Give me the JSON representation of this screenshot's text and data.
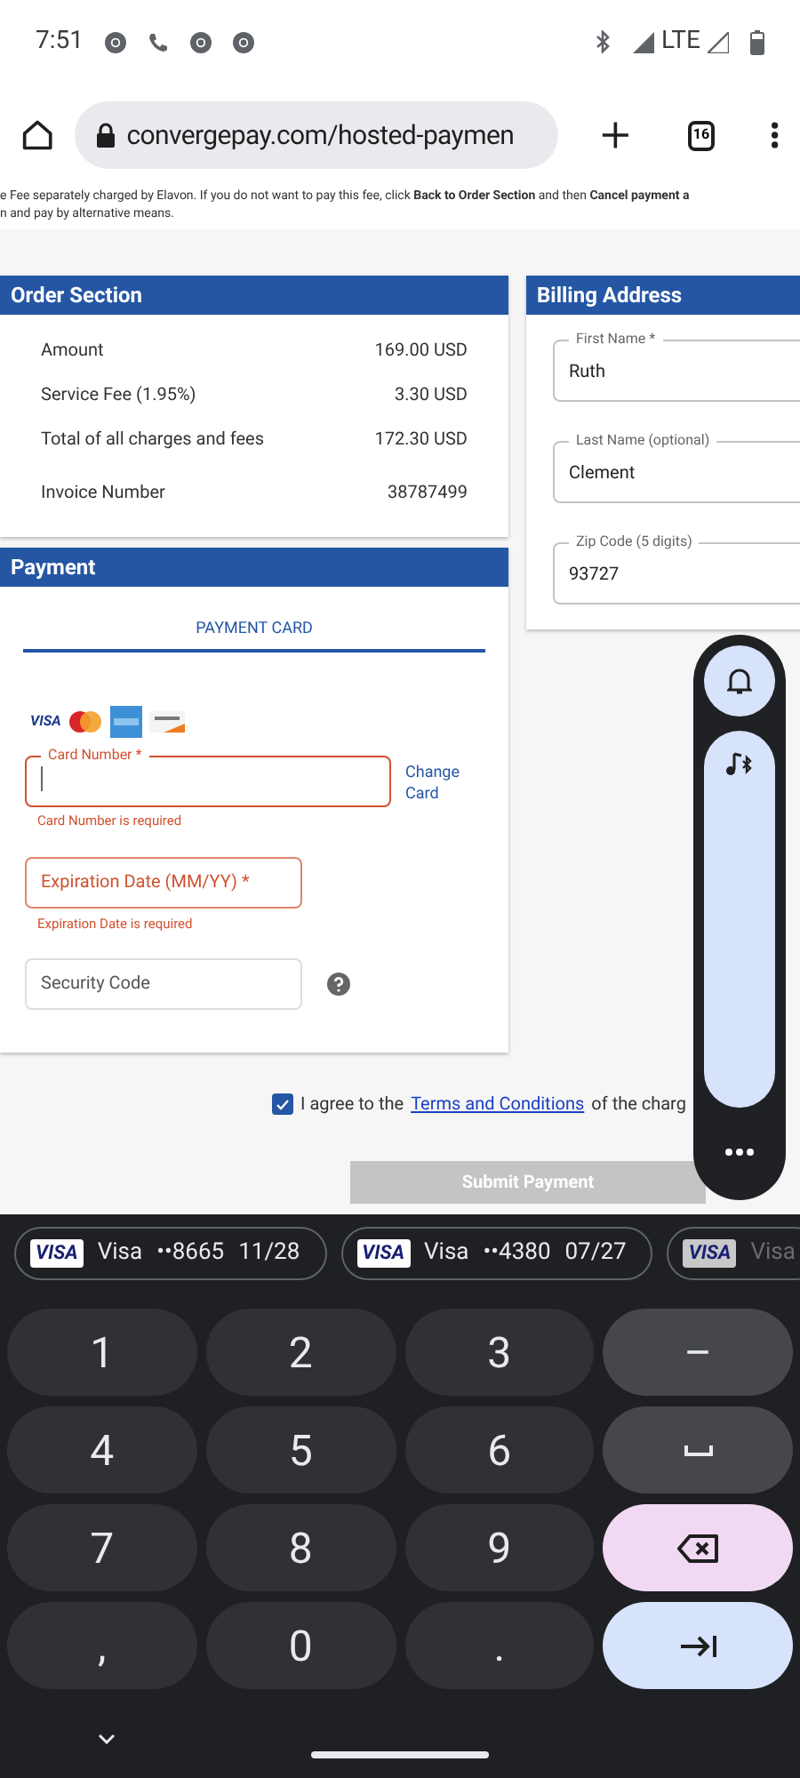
{
  "status_bar": {
    "time": "7:51",
    "network": "LTE"
  },
  "browser": {
    "url": "convergepay.com/hosted-paymen",
    "tab_count": "16"
  },
  "notice": [
    "e Fee separately charged by Elavon. If you do not want to pay this fee, click **Back to Order Section** and then **Cancel payment a**",
    "n and pay by alternative means."
  ],
  "order_section": {
    "title": "Order Section",
    "rows": [
      {
        "label": "Amount",
        "value": "169.00 USD"
      },
      {
        "label": "Service Fee (1.95%)",
        "value": "3.30 USD"
      },
      {
        "label": "Total of all charges and fees",
        "value": "172.30 USD"
      },
      {
        "label": "Invoice Number",
        "value": "38787499"
      }
    ]
  },
  "payment": {
    "title": "Payment",
    "tabs": [
      {
        "label": "PAYMENT CARD",
        "selected": true
      }
    ],
    "card_logos": [
      {
        "kind": "visa",
        "text": "VISA"
      },
      {
        "kind": "mastercard"
      },
      {
        "kind": "amex"
      },
      {
        "kind": "discover"
      }
    ],
    "card_number": {
      "label": "Card Number *",
      "error": "Card Number is required",
      "invalid": true,
      "focused": true
    },
    "change_card": "Change Card",
    "expiration": {
      "placeholder": "Expiration Date (MM/YY) *",
      "error": "Expiration Date is required",
      "invalid": true
    },
    "security_code": {
      "placeholder": "Security Code"
    }
  },
  "billing": {
    "title": "Billing Address",
    "fields": [
      {
        "label": "First Name *",
        "value": "Ruth"
      },
      {
        "label": "Last Name (optional)",
        "value": "Clement"
      },
      {
        "label": "Zip Code (5 digits)",
        "value": "93727"
      }
    ]
  },
  "agreement": {
    "checked": true,
    "before": "I agree to the",
    "link": "Terms and Conditions",
    "after": "of the charg"
  },
  "submit": {
    "label": "Submit Payment",
    "disabled": true
  },
  "keyboard": {
    "suggestions": [
      {
        "brand": "VISA",
        "name": "Visa",
        "number": "••8665",
        "expiry": "11/28",
        "faded": false
      },
      {
        "brand": "VISA",
        "name": "Visa",
        "number": "••4380",
        "expiry": "07/27",
        "faded": false
      },
      {
        "brand": "VISA",
        "name": "Visa",
        "faded": true
      }
    ],
    "keys": [
      {
        "kind": "char",
        "label": "1"
      },
      {
        "kind": "char",
        "label": "2"
      },
      {
        "kind": "char",
        "label": "3"
      },
      {
        "kind": "symbol",
        "label": "–"
      },
      {
        "kind": "char",
        "label": "4"
      },
      {
        "kind": "char",
        "label": "5"
      },
      {
        "kind": "char",
        "label": "6"
      },
      {
        "kind": "space"
      },
      {
        "kind": "char",
        "label": "7"
      },
      {
        "kind": "char",
        "label": "8"
      },
      {
        "kind": "char",
        "label": "9"
      },
      {
        "kind": "backspace"
      },
      {
        "kind": "char",
        "label": ","
      },
      {
        "kind": "char",
        "label": "0"
      },
      {
        "kind": "char",
        "label": "."
      },
      {
        "kind": "next"
      }
    ]
  }
}
